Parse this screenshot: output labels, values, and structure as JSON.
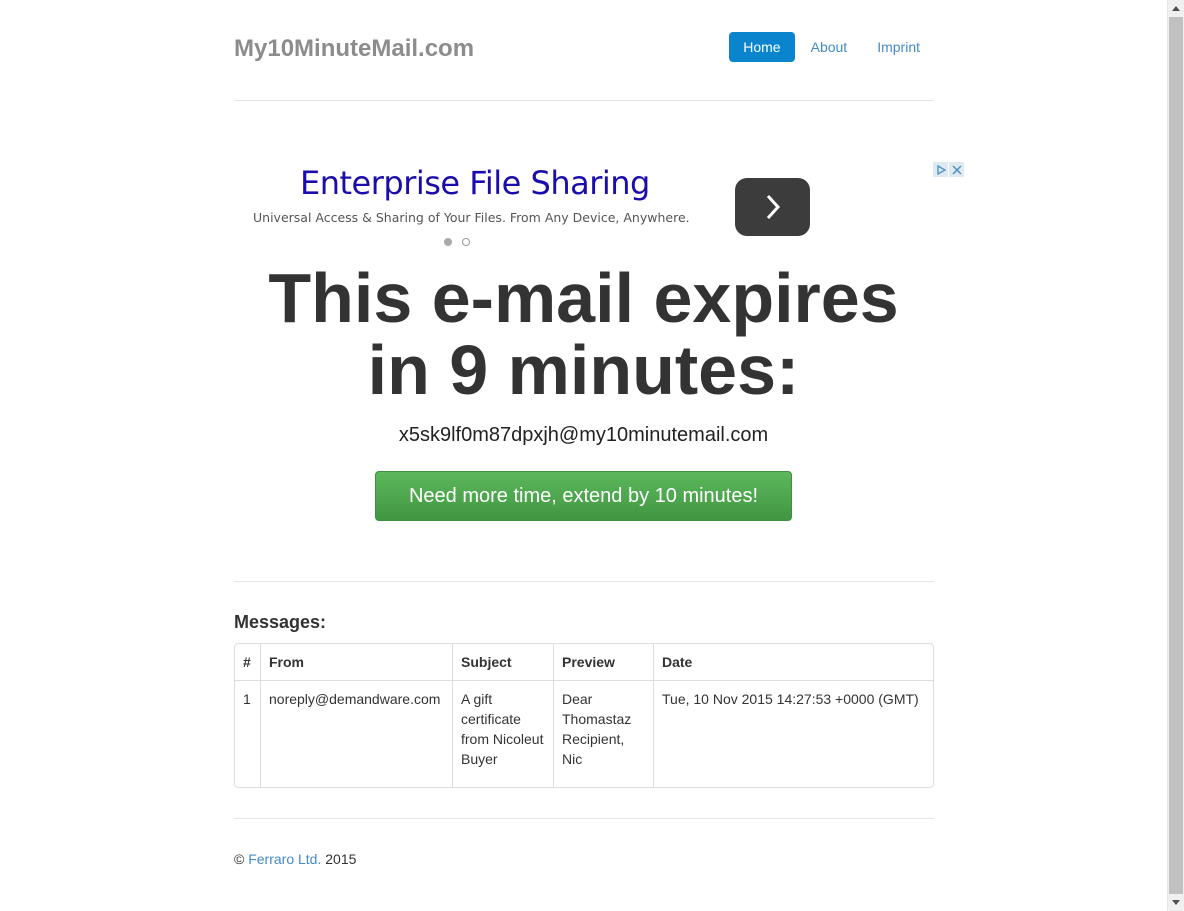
{
  "header": {
    "brand": "My10MinuteMail.com",
    "nav": [
      {
        "label": "Home",
        "active": true
      },
      {
        "label": "About",
        "active": false
      },
      {
        "label": "Imprint",
        "active": false
      }
    ]
  },
  "ad": {
    "title": "Enterprise File Sharing",
    "subtitle": "Universal Access & Sharing of Your Files. From Any Device, Anywhere.",
    "arrow_icon": "chevron-right-icon",
    "badges": [
      "adchoices-icon",
      "close-icon"
    ]
  },
  "main": {
    "headline_line1": "This e-mail expires",
    "headline_line2": "in 9 minutes:",
    "email_address": "x5sk9lf0m87dpxjh@my10minutemail.com",
    "extend_button": "Need more time, extend by 10 minutes!"
  },
  "messages": {
    "title": "Messages:",
    "columns": [
      "#",
      "From",
      "Subject",
      "Preview",
      "Date"
    ],
    "rows": [
      [
        "1",
        "noreply@demandware.com",
        "A gift certificate from Nicoleut Buyer",
        "Dear Thomastaz Recipient, Nic",
        "Tue, 10 Nov 2015 14:27:53 +0000 (GMT)"
      ]
    ]
  },
  "footer": {
    "copyright": "©",
    "company": "Ferraro Ltd.",
    "year": "2015"
  },
  "colors": {
    "accent": "#0b84ce",
    "link": "#428bca",
    "button_green": "#5cb85c",
    "ad_title": "#1a0dab"
  }
}
